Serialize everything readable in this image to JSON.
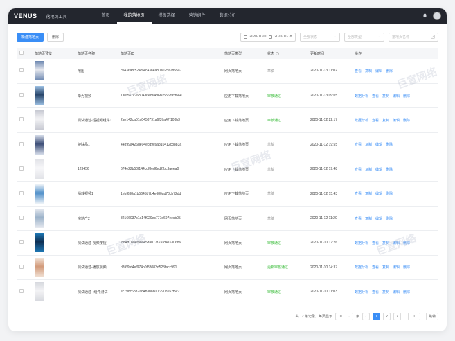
{
  "header": {
    "logo": "VENUS",
    "logo_sub": "",
    "app_name": "落地页工具",
    "nav": [
      {
        "label": "首页"
      },
      {
        "label": "我的落地页"
      },
      {
        "label": "模板选择"
      },
      {
        "label": "营销组件"
      },
      {
        "label": "数据分析"
      }
    ]
  },
  "toolbar": {
    "create_label": "新建落地页",
    "delete_label": "删除",
    "date_start": "2020-11-01",
    "date_end": "2020-11-18",
    "status_placeholder": "全部状态",
    "type_placeholder": "全部类型",
    "search_placeholder": "落地页名称"
  },
  "table": {
    "headers": [
      "落地页预览",
      "落地页名称",
      "落地页ID",
      "落地页类型",
      "状态",
      "更新时间",
      "操作"
    ],
    "rows": [
      {
        "name": "地图",
        "id": "c0436a8f524df4c438ea80a025a2855a7",
        "type": "网页落地页",
        "status": "草稿",
        "status_kind": "draft",
        "time": "2020-11-13 11:02",
        "ops": [
          "查看",
          "复制",
          "编辑",
          "删除"
        ],
        "thumb": [
          "#e6e8ee",
          "#6b86b0"
        ]
      },
      {
        "name": "华为视频",
        "id": "1a0f567c2680436e8649680556b95f66e",
        "type": "应用下载落地页",
        "status": "审核通过",
        "status_kind": "ok",
        "time": "2020-11-13 09:05",
        "ops": [
          "数据分析",
          "查看",
          "复制",
          "编辑",
          "删除"
        ],
        "thumb": [
          "#29466b",
          "#9fc3e6"
        ]
      },
      {
        "name": "测试通过-短视频组件1",
        "id": "2ae142ca01a0458791a6f37a47f108b3",
        "type": "应用下载落地页",
        "status": "审核通过",
        "status_kind": "ok",
        "time": "2020-11-12 22:17",
        "ops": [
          "数据分析",
          "查看",
          "复制",
          "编辑",
          "删除"
        ],
        "thumb": [
          "#f3f3f5",
          "#c7c9d2"
        ]
      },
      {
        "name": "护肤品1",
        "id": "44b99a426de04ecd9c6a810412c8883a",
        "type": "应用下载落地页",
        "status": "草稿",
        "status_kind": "draft",
        "time": "2020-11-12 19:55",
        "ops": [
          "查看",
          "复制",
          "编辑",
          "删除"
        ],
        "thumb": [
          "#3e4f78",
          "#d4dbe9"
        ]
      },
      {
        "name": "123456",
        "id": "674e22b50f144cdf8ed6ed2fbc9aeea0",
        "type": "应用下载落地页",
        "status": "草稿",
        "status_kind": "draft",
        "time": "2020-11-12 19:48",
        "ops": [
          "查看",
          "复制",
          "编辑",
          "删除"
        ],
        "thumb": [
          "#f7f7f9",
          "#e2e3e8"
        ]
      },
      {
        "name": "播放视频1",
        "id": "1ebf638a1b5645b7b4e680ad73cb72dd",
        "type": "应用下载落地页",
        "status": "草稿",
        "status_kind": "draft",
        "time": "2020-11-12 15:43",
        "ops": [
          "查看",
          "复制",
          "编辑",
          "删除"
        ],
        "thumb": [
          "#4f8fc9",
          "#eef3f8"
        ]
      },
      {
        "name": "房地产2",
        "id": "82166037c1a14f029ec777d697eecb05",
        "type": "网页落地页",
        "status": "草稿",
        "status_kind": "draft",
        "time": "2020-11-12 11:20",
        "ops": [
          "查看",
          "复制",
          "编辑",
          "删除"
        ],
        "thumb": [
          "#9bb2c9",
          "#e7eaf0"
        ]
      },
      {
        "name": "测试通过-视频按钮",
        "id": "fcd4d1804f9ee45dab77f330d41630686",
        "type": "网页落地页",
        "status": "审核通过",
        "status_kind": "ok",
        "time": "2020-11-10 17:26",
        "ops": [
          "数据分析",
          "查看",
          "复制",
          "编辑",
          "删除"
        ],
        "thumb": [
          "#0f2f53",
          "#1e7ab8"
        ]
      },
      {
        "name": "测试通过-播放视频",
        "id": "d8f69fd4ef974b0f83083d523facc991",
        "type": "网页落地页",
        "status": "更新审核通过",
        "status_kind": "ok",
        "time": "2020-11-10 14:37",
        "ops": [
          "数据分析",
          "查看",
          "复制",
          "编辑",
          "删除"
        ],
        "thumb": [
          "#d29a7a",
          "#f1e2d6"
        ]
      },
      {
        "name": "测试通过--组件测试",
        "id": "ec798c6b32a84b3b8800f790b552f5c2",
        "type": "网页落地页",
        "status": "审核通过",
        "status_kind": "ok",
        "time": "2020-11-10 11:03",
        "ops": [
          "数据分析",
          "查看",
          "复制",
          "编辑",
          "删除"
        ],
        "thumb": [
          "#f3f3f5",
          "#d6d8de"
        ]
      }
    ]
  },
  "pagination": {
    "total_text": "共 12 条记录，每页显示",
    "page_size": "10",
    "unit": "条",
    "pages": [
      "1",
      "2"
    ],
    "current": "1",
    "jump_value": "1",
    "jump_label": "跳转"
  },
  "watermark": "巨宣网络"
}
